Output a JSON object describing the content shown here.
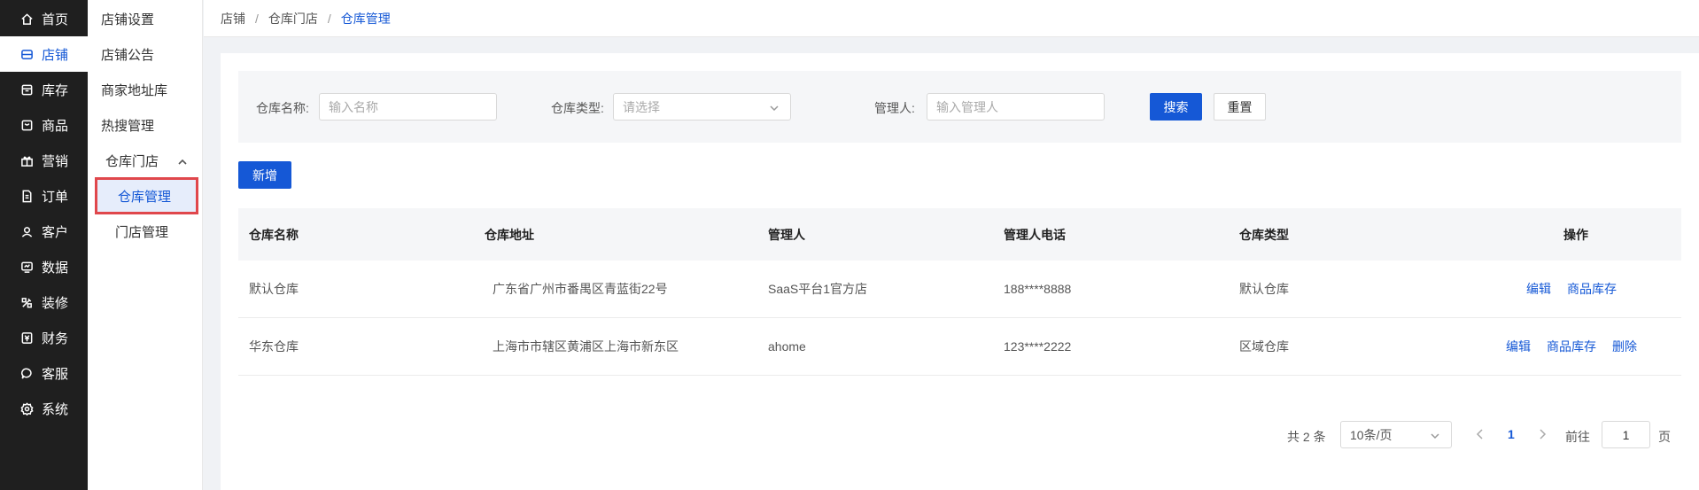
{
  "nav": {
    "items": [
      {
        "label": "首页",
        "icon": "home-icon"
      },
      {
        "label": "店铺",
        "icon": "store-icon"
      },
      {
        "label": "库存",
        "icon": "inventory-icon"
      },
      {
        "label": "商品",
        "icon": "goods-icon"
      },
      {
        "label": "营销",
        "icon": "gift-icon"
      },
      {
        "label": "订单",
        "icon": "order-icon"
      },
      {
        "label": "客户",
        "icon": "customer-icon"
      },
      {
        "label": "数据",
        "icon": "data-icon"
      },
      {
        "label": "装修",
        "icon": "decorate-icon"
      },
      {
        "label": "财务",
        "icon": "finance-icon"
      },
      {
        "label": "客服",
        "icon": "chat-icon"
      },
      {
        "label": "系统",
        "icon": "settings-icon"
      }
    ],
    "active_index": 1
  },
  "submenu": {
    "items": [
      {
        "label": "店铺设置"
      },
      {
        "label": "店铺公告"
      },
      {
        "label": "商家地址库"
      },
      {
        "label": "热搜管理"
      },
      {
        "label": "仓库门店"
      },
      {
        "label": "仓库管理"
      },
      {
        "label": "门店管理"
      }
    ]
  },
  "breadcrumb": {
    "items": [
      "店铺",
      "仓库门店",
      "仓库管理"
    ],
    "separator": "/"
  },
  "filter": {
    "name_label": "仓库名称:",
    "name_placeholder": "输入名称",
    "type_label": "仓库类型:",
    "type_placeholder": "请选择",
    "manager_label": "管理人:",
    "manager_placeholder": "输入管理人",
    "search_label": "搜索",
    "reset_label": "重置"
  },
  "toolbar": {
    "add_label": "新增"
  },
  "table": {
    "columns": [
      "仓库名称",
      "仓库地址",
      "管理人",
      "管理人电话",
      "仓库类型",
      "操作"
    ],
    "rows": [
      {
        "name": "默认仓库",
        "address": "广东省广州市番禺区青蓝街22号",
        "manager": "SaaS平台1官方店",
        "phone": "188****8888",
        "type": "默认仓库",
        "actions": [
          "编辑",
          "商品库存"
        ]
      },
      {
        "name": "华东仓库",
        "address": "上海市市辖区黄浦区上海市新东区",
        "manager": "ahome",
        "phone": "123****2222",
        "type": "区域仓库",
        "actions": [
          "编辑",
          "商品库存",
          "删除"
        ]
      }
    ]
  },
  "pagination": {
    "total_text": "共 2 条",
    "page_size": "10条/页",
    "current_page": "1",
    "goto_label": "前往",
    "goto_value": "1",
    "page_suffix": "页"
  },
  "colors": {
    "primary": "#1558d6",
    "nav_bg": "#1f1f1f",
    "highlight_border": "#e0474c"
  }
}
